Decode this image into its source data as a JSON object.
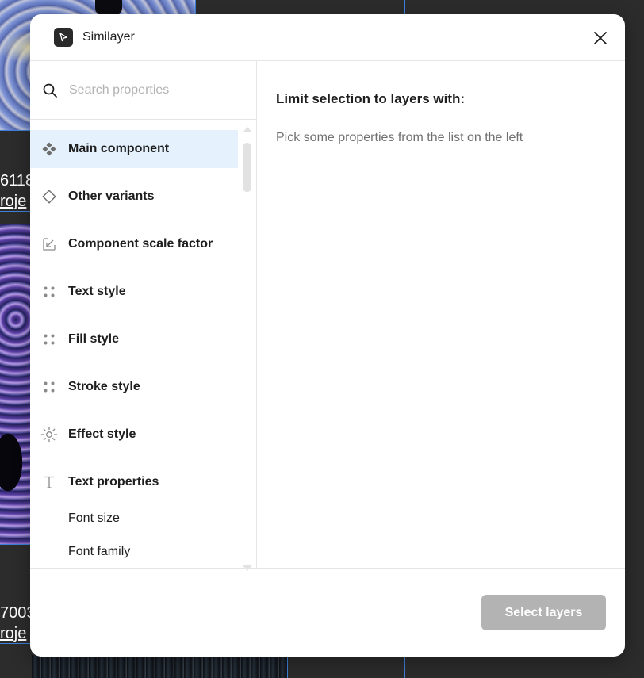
{
  "backdrop": {
    "labels": [
      "6118",
      "roje",
      "7003",
      "roje"
    ]
  },
  "header": {
    "app_title": "Similayer",
    "app_icon": "cursor-arrow-icon",
    "close_icon": "close-icon"
  },
  "search": {
    "placeholder": "Search properties",
    "value": "",
    "icon": "search-icon"
  },
  "properties": [
    {
      "label": "Main component",
      "icon": "component-icon",
      "selected": true
    },
    {
      "label": "Other variants",
      "icon": "diamond-icon",
      "selected": false
    },
    {
      "label": "Component scale factor",
      "icon": "scale-icon",
      "selected": false
    },
    {
      "label": "Text style",
      "icon": "style-dots-icon",
      "selected": false
    },
    {
      "label": "Fill style",
      "icon": "style-dots-icon",
      "selected": false
    },
    {
      "label": "Stroke style",
      "icon": "style-dots-icon",
      "selected": false
    },
    {
      "label": "Effect style",
      "icon": "sun-icon",
      "selected": false
    },
    {
      "label": "Text properties",
      "icon": "text-icon",
      "selected": false
    }
  ],
  "text_subproperties": [
    "Font size",
    "Font family"
  ],
  "main": {
    "heading": "Limit selection to layers with:",
    "hint": "Pick some properties from the list on the left"
  },
  "footer": {
    "select_label": "Select layers"
  },
  "colors": {
    "selected_row": "#e5f2fd",
    "disabled_button": "#b3b3b3",
    "canvas_bg": "#2c2c2c"
  }
}
